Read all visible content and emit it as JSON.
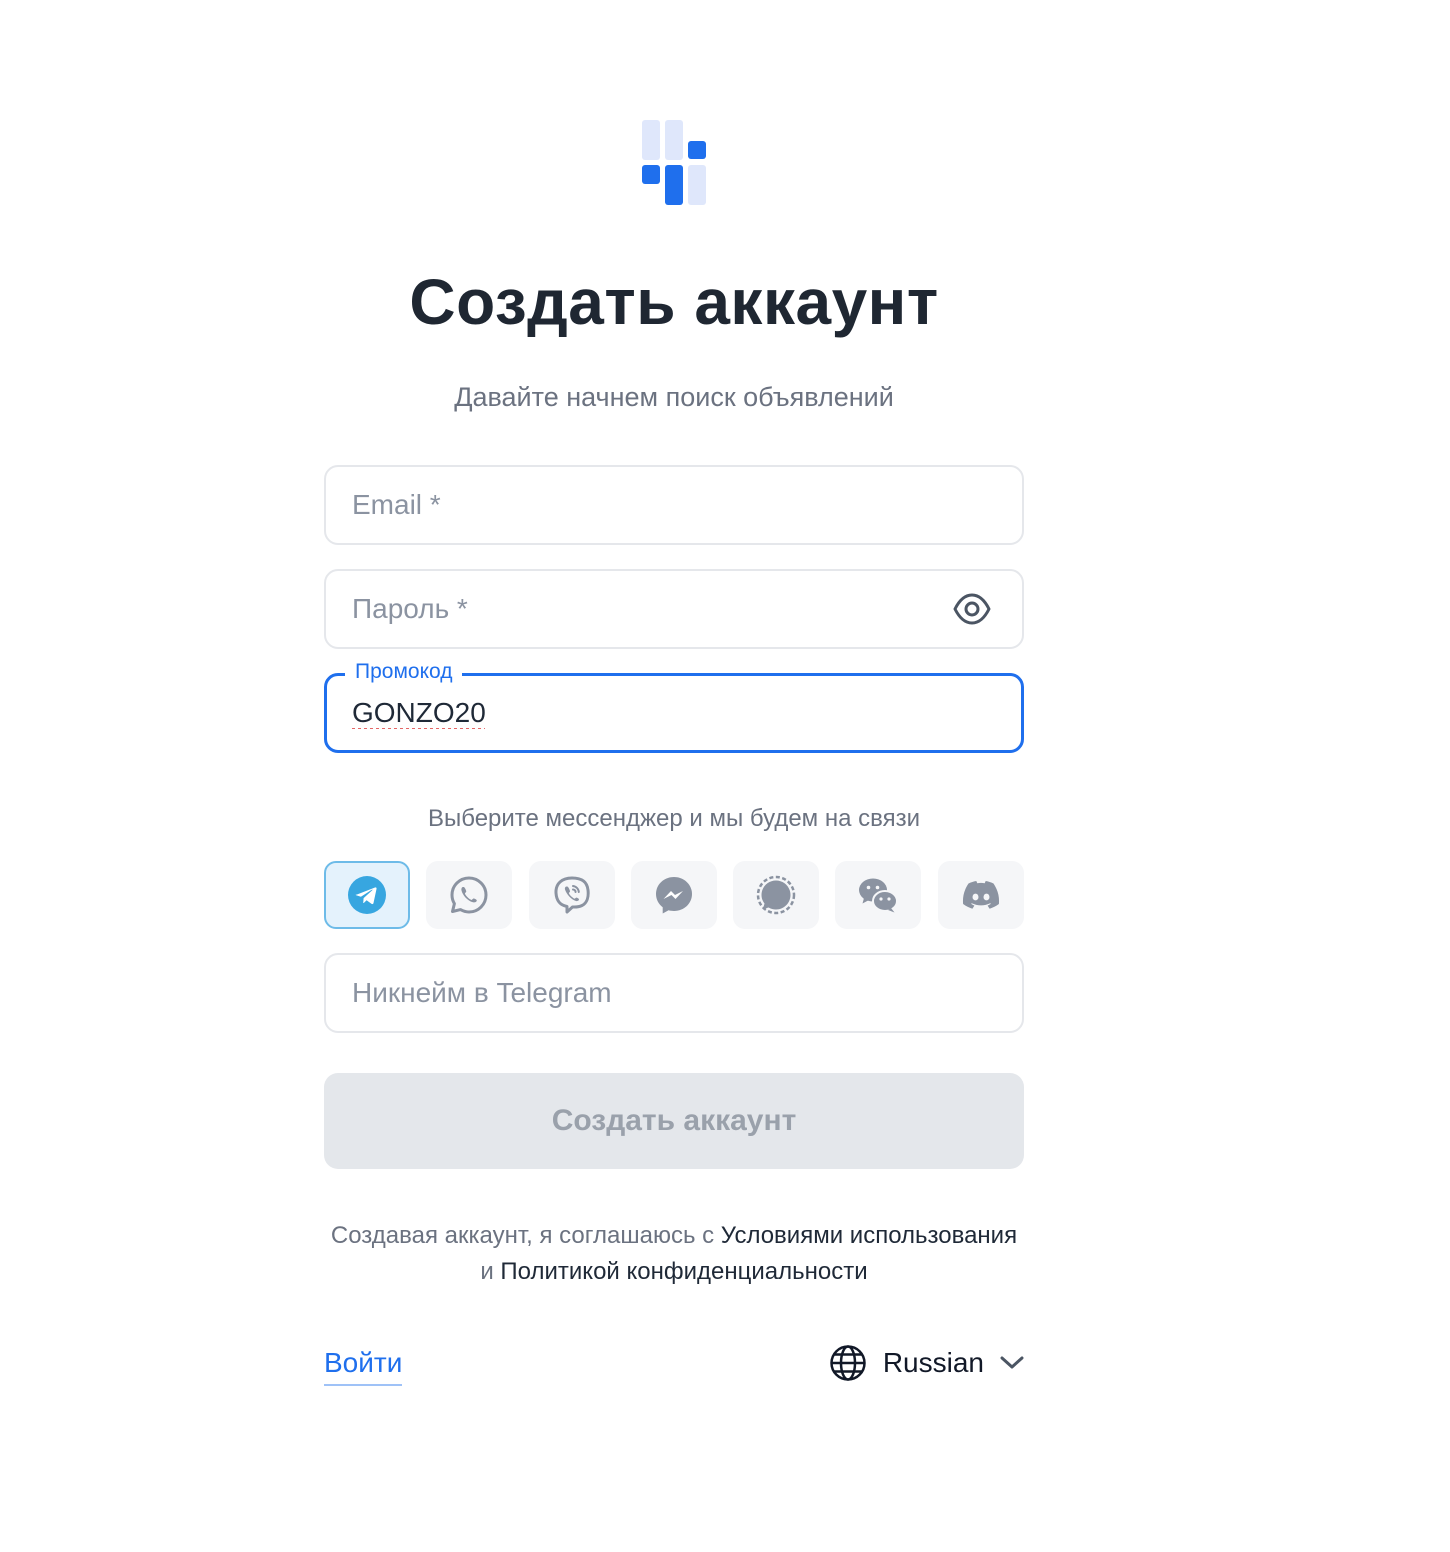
{
  "header": {
    "title": "Создать аккаунт",
    "subtitle": "Давайте начнем поиск объявлений"
  },
  "form": {
    "email": {
      "placeholder": "Email *",
      "value": ""
    },
    "password": {
      "placeholder": "Пароль *",
      "value": ""
    },
    "promo": {
      "label": "Промокод",
      "value": "GONZO20"
    },
    "messenger_caption": "Выберите мессенджер и мы будем на связи",
    "messengers": [
      {
        "name": "telegram",
        "selected": true
      },
      {
        "name": "whatsapp",
        "selected": false
      },
      {
        "name": "viber",
        "selected": false
      },
      {
        "name": "messenger",
        "selected": false
      },
      {
        "name": "signal",
        "selected": false
      },
      {
        "name": "wechat",
        "selected": false
      },
      {
        "name": "discord",
        "selected": false
      }
    ],
    "nickname": {
      "placeholder": "Никнейм в Telegram",
      "value": ""
    },
    "submit_label": "Создать аккаунт"
  },
  "terms": {
    "prefix": "Создавая аккаунт, я соглашаюсь с ",
    "terms_link": "Условиями использования",
    "conjunction": " и ",
    "privacy_link": "Политикой конфиденциальности"
  },
  "footer": {
    "login_label": "Войти",
    "language": "Russian"
  },
  "colors": {
    "accent": "#1f6fed",
    "logo_light": "#dfe7fb",
    "telegram": "#37a6e0",
    "icon_gray": "#8b93a1"
  }
}
